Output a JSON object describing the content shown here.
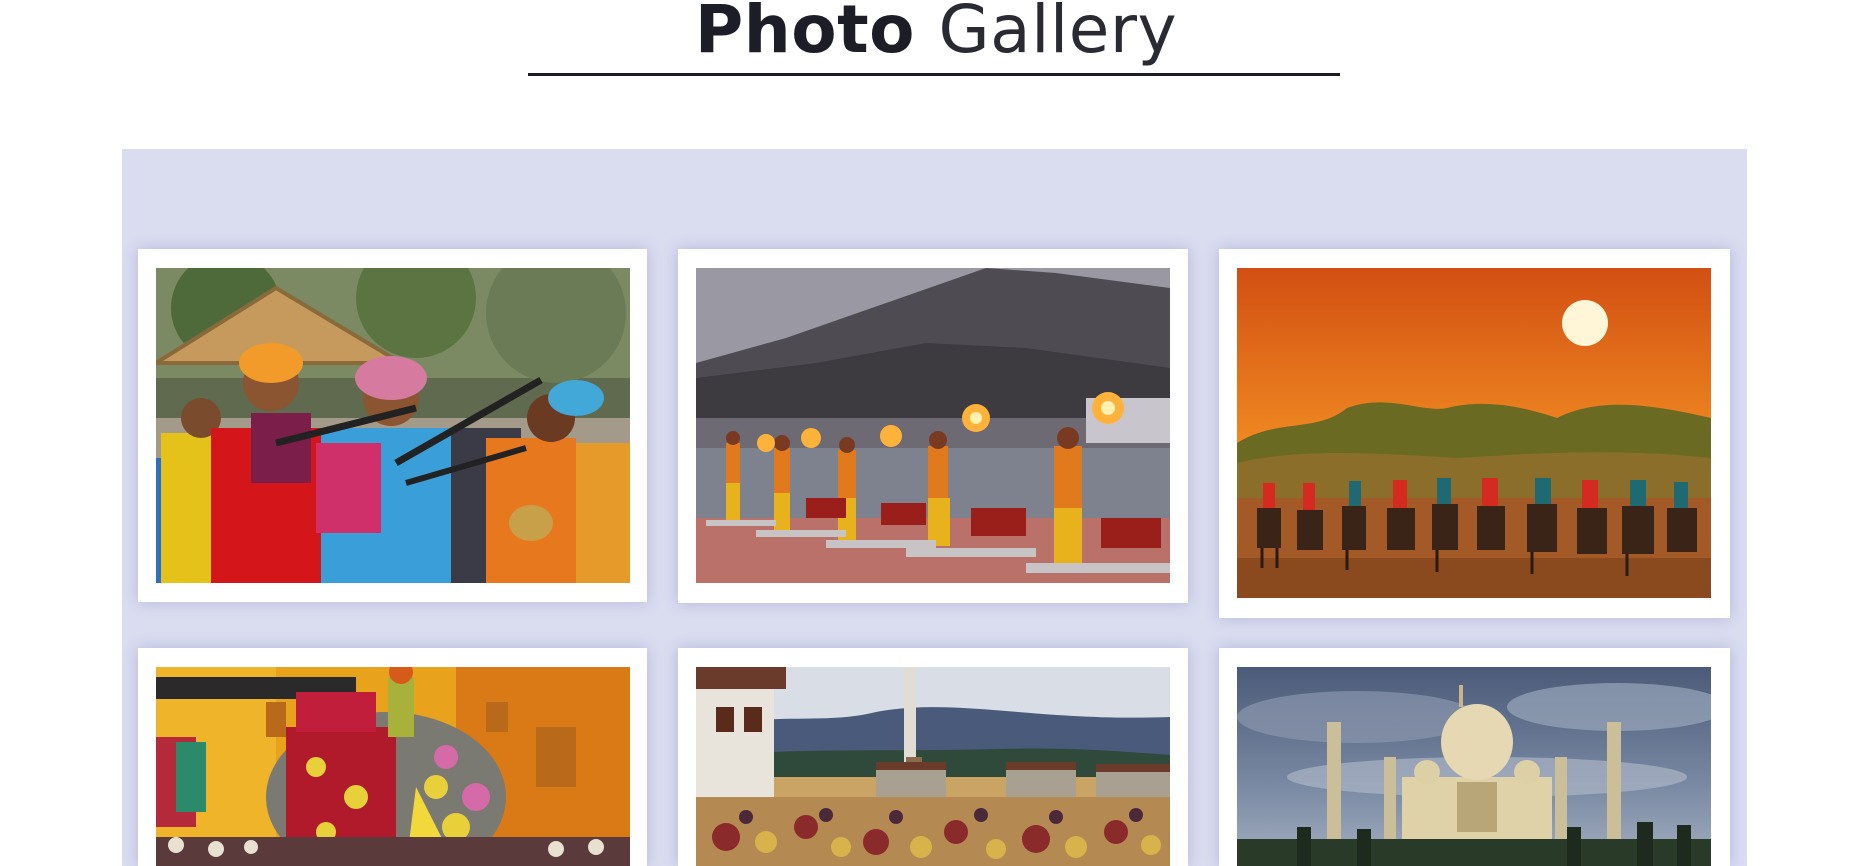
{
  "gallery": {
    "title_bold": "Photo",
    "title_light": "Gallery",
    "photos": [
      {
        "subject": "folk-musicians",
        "accent": "#e35a1c"
      },
      {
        "subject": "river-fire-ceremony",
        "accent": "#f29a2a"
      },
      {
        "subject": "desert-horse-riders",
        "accent": "#e88420"
      },
      {
        "subject": "decorated-elephant-festival",
        "accent": "#e0a21d"
      },
      {
        "subject": "mountain-monastery-festival",
        "accent": "#c48a3c"
      },
      {
        "subject": "taj-mahal",
        "accent": "#e6d6b0"
      }
    ]
  }
}
